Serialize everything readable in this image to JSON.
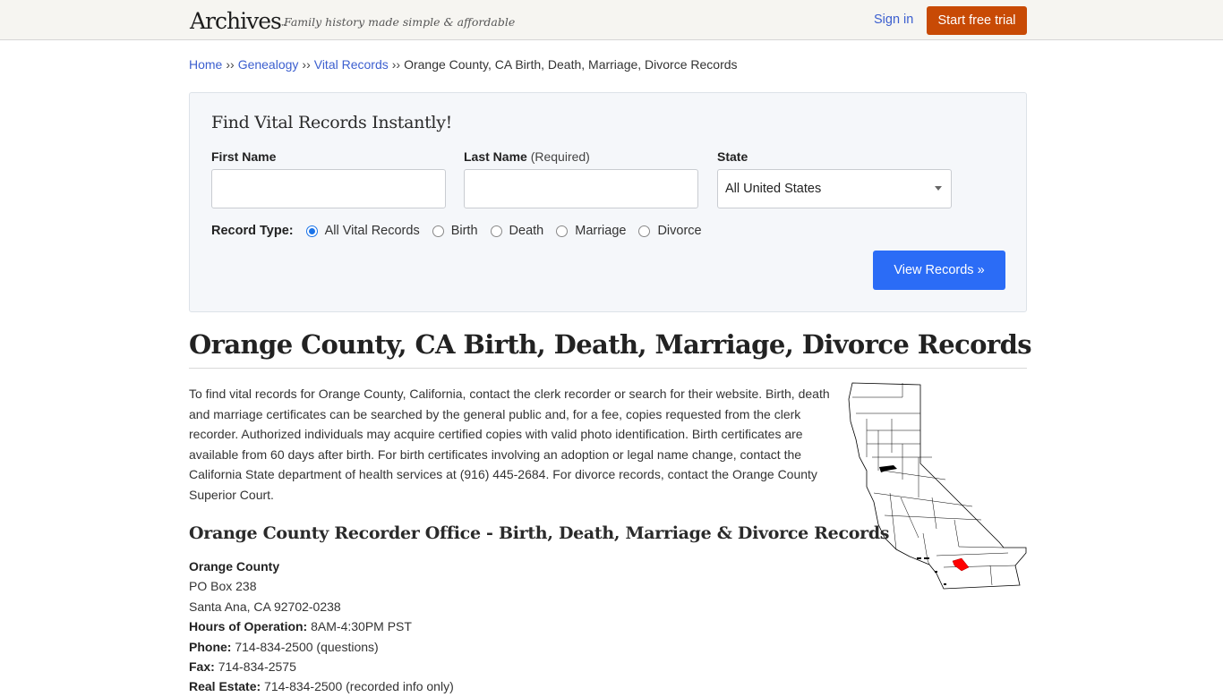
{
  "header": {
    "logo": "Archives",
    "logo_tm": "™",
    "tagline": "Family history made simple & affordable",
    "sign_in": "Sign in",
    "start_trial": "Start free trial"
  },
  "breadcrumb": {
    "items": [
      "Home",
      "Genealogy",
      "Vital Records"
    ],
    "separator": "››",
    "current": "Orange County, CA Birth, Death, Marriage, Divorce Records"
  },
  "search": {
    "title": "Find Vital Records Instantly!",
    "first_name_label": "First Name",
    "first_name_value": "",
    "last_name_label": "Last Name",
    "last_name_required": "(Required)",
    "last_name_value": "",
    "state_label": "State",
    "state_value": "All United States",
    "record_type_label": "Record Type:",
    "record_types": [
      {
        "label": "All Vital Records",
        "checked": true
      },
      {
        "label": "Birth",
        "checked": false
      },
      {
        "label": "Death",
        "checked": false
      },
      {
        "label": "Marriage",
        "checked": false
      },
      {
        "label": "Divorce",
        "checked": false
      }
    ],
    "submit": "View Records »"
  },
  "page": {
    "title": "Orange County, CA Birth, Death, Marriage, Divorce Records",
    "intro": "To find vital records for Orange County, California, contact the clerk recorder or search for their website. Birth, death and marriage certificates can be searched by the general public and, for a fee, copies requested from the clerk recorder. Authorized individuals may acquire certified copies with valid photo identification. Birth certificates are available from 60 days after birth. For birth certificates involving an adoption or legal name change, contact the California State department of health services at (916) 445-2684. For divorce records, contact the Orange County Superior Court.",
    "map_alt": "California county map with Orange County highlighted",
    "map_highlight_color": "#ff0000",
    "section_title": "Orange County Recorder Office - Birth, Death, Marriage & Divorce Records"
  },
  "office": {
    "name": "Orange County",
    "address1": "PO Box 238",
    "address2": "Santa Ana, CA 92702-0238",
    "hours_label": "Hours of Operation:",
    "hours": "8AM-4:30PM PST",
    "phone_label": "Phone:",
    "phone": "714-834-2500 (questions)",
    "fax_label": "Fax:",
    "fax": "714-834-2575",
    "real_estate_label": "Real Estate:",
    "real_estate": "714-834-2500 (recorded info only)"
  },
  "colors": {
    "link": "#3c5fcf",
    "trial_button": "#c84a05",
    "view_button": "#2b6cf6"
  }
}
